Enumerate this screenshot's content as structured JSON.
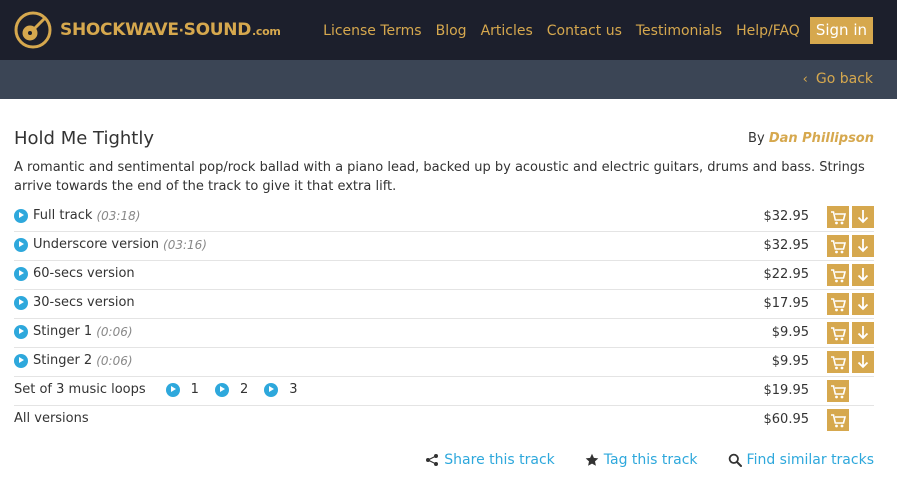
{
  "header": {
    "logo_main": "SHOCKWAVE",
    "logo_sep": "·",
    "logo_second": "SOUND",
    "logo_tld": ".com",
    "nav": [
      {
        "label": "License Terms"
      },
      {
        "label": "Blog"
      },
      {
        "label": "Articles"
      },
      {
        "label": "Contact us"
      },
      {
        "label": "Testimonials"
      },
      {
        "label": "Help/FAQ"
      }
    ],
    "sign_in": "Sign in"
  },
  "subbar": {
    "go_back": "Go back"
  },
  "track": {
    "title": "Hold Me Tightly",
    "by_label": "By",
    "author": "Dan Phillipson",
    "description": "A romantic and sentimental pop/rock ballad with a piano lead, backed up by acoustic and electric guitars, drums and bass. Strings arrive towards the end of the track to give it that extra lift."
  },
  "versions": [
    {
      "name": "Full track",
      "duration": "(03:18)",
      "price": "$32.95"
    },
    {
      "name": "Underscore version",
      "duration": "(03:16)",
      "price": "$32.95"
    },
    {
      "name": "60-secs version",
      "duration": "",
      "price": "$22.95"
    },
    {
      "name": "30-secs version",
      "duration": "",
      "price": "$17.95"
    },
    {
      "name": "Stinger 1",
      "duration": "(0:06)",
      "price": "$9.95"
    },
    {
      "name": "Stinger 2",
      "duration": "(0:06)",
      "price": "$9.95"
    }
  ],
  "loops": {
    "name": "Set of 3 music loops",
    "items": [
      "1",
      "2",
      "3"
    ],
    "price": "$19.95"
  },
  "all_versions": {
    "name": "All versions",
    "price": "$60.95"
  },
  "actions": {
    "share": "Share this track",
    "tag": "Tag this track",
    "similar": "Find similar tracks"
  },
  "icons": {
    "logo": "guitar-logo-icon",
    "play": "play-circle-icon",
    "cart": "shopping-cart-icon",
    "download": "download-arrow-icon",
    "share": "share-icon",
    "tag": "star-icon",
    "similar": "search-icon",
    "back": "chevron-left-icon"
  },
  "colors": {
    "brand": "#d6a84e",
    "header_bg": "#1c1f2c",
    "subbar_bg": "#3b4555",
    "link": "#2ea8dc"
  }
}
